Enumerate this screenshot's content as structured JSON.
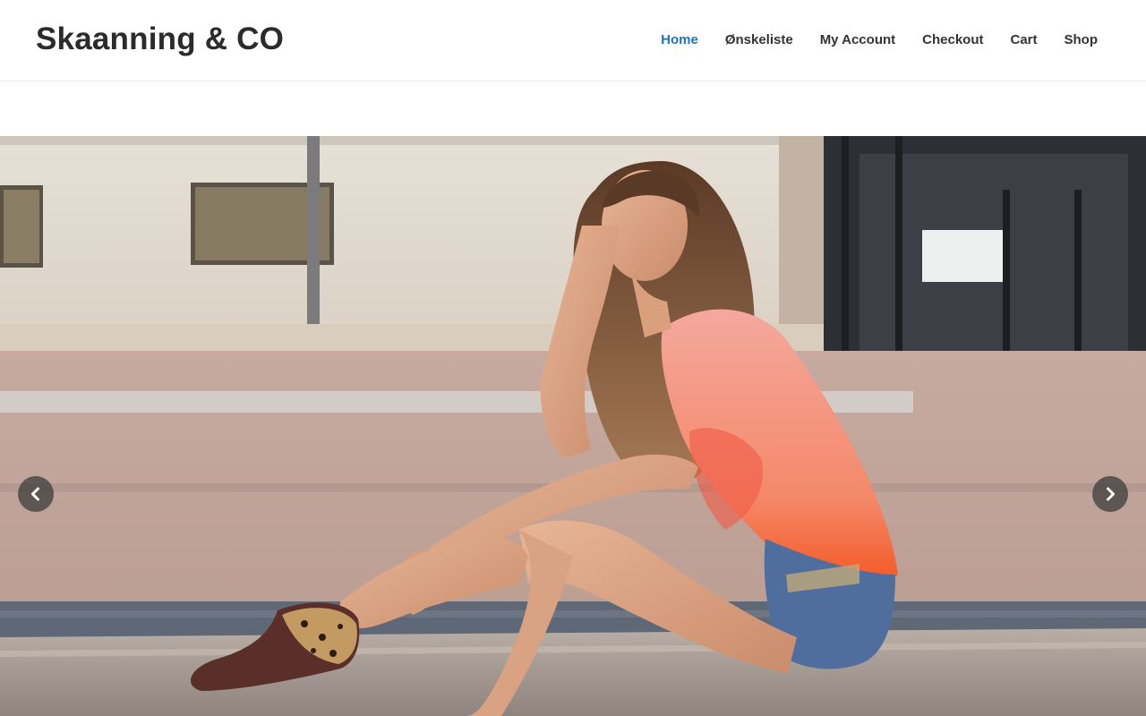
{
  "site": {
    "title": "Skaanning & CO"
  },
  "nav": {
    "items": [
      {
        "label": "Home",
        "active": true
      },
      {
        "label": "Ønskeliste",
        "active": false
      },
      {
        "label": "My Account",
        "active": false
      },
      {
        "label": "Checkout",
        "active": false
      },
      {
        "label": "Cart",
        "active": false
      },
      {
        "label": "Shop",
        "active": false
      }
    ],
    "active_color": "#1e73be"
  },
  "slider": {
    "prev_icon": "chevron-left-icon",
    "next_icon": "chevron-right-icon",
    "image": "hero-photo-woman-sitting-on-curb"
  }
}
